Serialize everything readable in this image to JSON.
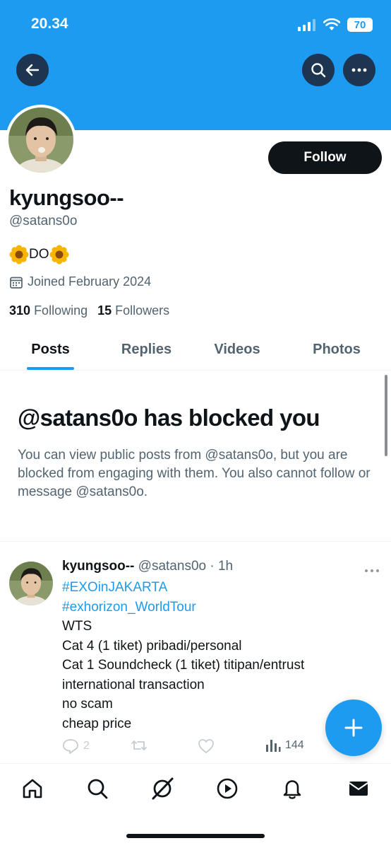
{
  "status_bar": {
    "time": "20.34",
    "battery": "70"
  },
  "profile": {
    "display_name": "kyungsoo--",
    "handle": "@satans0o",
    "bio_text": "DO",
    "joined": "Joined February 2024",
    "following_count": "310",
    "following_label": "Following",
    "followers_count": "15",
    "followers_label": "Followers",
    "follow_label": "Follow"
  },
  "tabs": [
    {
      "label": "Posts",
      "active": true
    },
    {
      "label": "Replies"
    },
    {
      "label": "Videos"
    },
    {
      "label": "Photos"
    }
  ],
  "blocked": {
    "title": "@satans0o has blocked you",
    "message": "You can view public posts from @satans0o, but you are blocked from engaging with them. You also cannot follow or message @satans0o."
  },
  "post": {
    "author": "kyungsoo--",
    "handle": "@satans0o",
    "time": "1h",
    "hashtags": [
      "#EXOinJAKARTA",
      "#exhorizon_WorldTour"
    ],
    "lines": [
      "WTS",
      "Cat 4 (1 tiket) pribadi/personal",
      "Cat 1 Soundcheck (1 tiket) titipan/entrust",
      "international transaction",
      "no scam",
      "cheap price"
    ],
    "replies": "2",
    "views": "144"
  },
  "icons": {
    "back": "arrow-left-icon",
    "search": "search-icon",
    "more": "more-icon",
    "calendar": "calendar-icon",
    "compose": "plus-icon",
    "nav": [
      "home-icon",
      "search-icon",
      "grok-icon",
      "video-icon",
      "bell-icon",
      "mail-icon"
    ]
  },
  "colors": {
    "accent": "#1d9bf0",
    "text": "#0f1419",
    "muted": "#536471",
    "follow_button": "#0f1419"
  }
}
